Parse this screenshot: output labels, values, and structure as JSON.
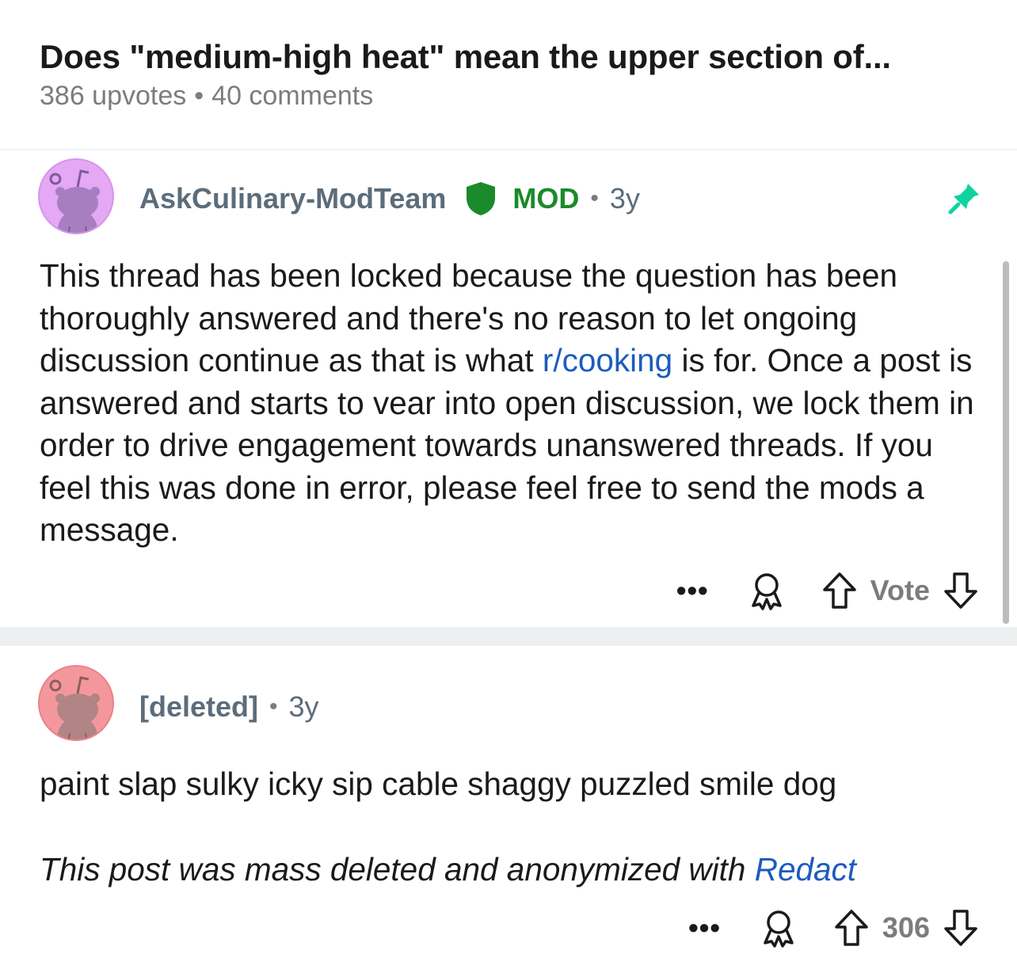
{
  "post": {
    "title": "Does \"medium-high heat\" mean the upper section of...",
    "upvotes": "386 upvotes",
    "separator": "•",
    "comments": "40 comments"
  },
  "comments": [
    {
      "author": "AskCulinary-ModTeam",
      "mod_label": "MOD",
      "separator": "•",
      "age": "3y",
      "avatar_color": "#e4a8f5",
      "pinned": true,
      "body_1": "This thread has been locked because the question has been thoroughly answered and there's no reason to let ongoing discussion continue as that is what ",
      "link": "r/cooking",
      "body_2": " is for.  Once a post is answered and starts to vear into open discussion, we lock them in order to drive engagement towards unanswered threads.  If you feel this was done in error, please feel free to send the mods a message.",
      "more": "•••",
      "vote_label": "Vote"
    },
    {
      "author": "[deleted]",
      "separator": "•",
      "age": "3y",
      "avatar_color": "#f4979c",
      "body_1": "paint slap sulky icky sip cable shaggy puzzled smile dog",
      "body_italic": "This post was mass deleted and anonymized with ",
      "link": "Redact",
      "more": "•••",
      "vote_label": "306"
    }
  ],
  "colors": {
    "mod_green": "#1b8a2a",
    "pin_green": "#0dd3a0",
    "link_blue": "#1d5bbf",
    "meta_gray": "#7c7c7c"
  },
  "icons": [
    "snoo-avatar-icon",
    "mod-shield-icon",
    "pin-icon",
    "more-icon",
    "award-icon",
    "upvote-icon",
    "downvote-icon"
  ]
}
